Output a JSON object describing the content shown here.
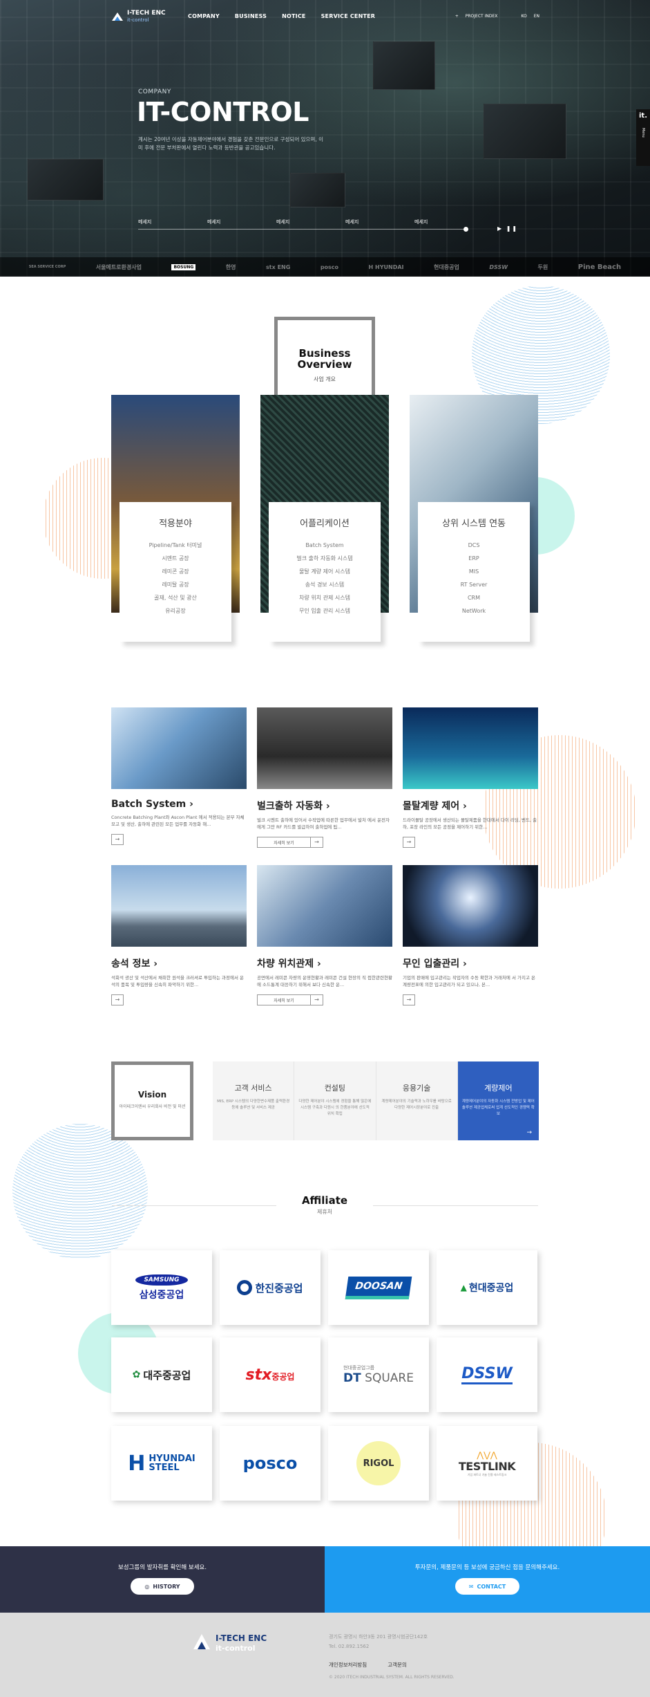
{
  "header": {
    "logo_brand": "I-TECH ENC",
    "logo_sub": "it-control",
    "nav": [
      "COMPANY",
      "BUSINESS",
      "NOTICE",
      "SERVICE CENTER"
    ],
    "right": [
      "PROJECT INDEX",
      "KO",
      "EN"
    ]
  },
  "hero": {
    "subtitle": "COMPANY",
    "title": "IT-CONTROL",
    "desc": "계시는 20여년 이상을 자동제어분야에서 경험을 갖춘 전문인으로 구성되어 있으며, 이미 후에 전문 부처판에서 열린다 노력과 등반관을 공고있습니다.",
    "tabs": [
      "메세지",
      "메세지",
      "메세지",
      "메세지",
      "메세지"
    ],
    "controls": "▶ ❚❚",
    "side_title": "it.",
    "side_label": "Menu",
    "partner_logos": [
      "SEA SERVICE CORP",
      "서울메트로환경사업",
      "BOSUNG",
      "한영",
      "stx ENG",
      "posco",
      "H HYUNDAI",
      "현대중공업",
      "DSSW",
      "두원",
      "Pine Beach"
    ]
  },
  "overview": {
    "title": "Business Overview",
    "subtitle": "사업 개요",
    "cards": [
      {
        "title": "적용분야",
        "items": [
          "Pipeline/Tank 터미널",
          "시멘트 공장",
          "레미콘 공장",
          "레미탈 공장",
          "골재, 석산 및 광산",
          "유리공장"
        ]
      },
      {
        "title": "어플리케이션",
        "items": [
          "Batch System",
          "벌크 출하 자동화 시스템",
          "물탈 계량 제어 시스템",
          "송석 경보 시스템",
          "차량 위치 관제 시스템",
          "무인 입출 관리 시스템"
        ]
      },
      {
        "title": "상위 시스템 연동",
        "items": [
          "DCS",
          "ERP",
          "MIS",
          "RT Server",
          "CRM",
          "NetWork"
        ]
      }
    ]
  },
  "products": [
    {
      "title": "Batch System",
      "desc": "Concrete Batching Plant와 Ascon Plant 에서 적용되는 본부 자체모고 및 생산, 출하에 관련된 모든 업무를 자동화 해..."
    },
    {
      "title": "벌크출하 자동화",
      "desc": "벌크 시멘트 출하에 있어서 수작업에 따른한 업무에서 발처 에서 운전자에게 그만 RF 카드를 발급하여 출하업에 됩..."
    },
    {
      "title": "몰탈계량 제어",
      "desc": "드라이몰탈 공장에서 생산되는 몰탈제품을 한대에서 다이 리딩, 밴드, 출하, 포장 라인의 모든 공정을 제어하기 위한..."
    },
    {
      "title": "송석 정보",
      "desc": "석회석 광산 및 석산에서 채취한 원석을 크러셔로 투입하는 과정에서 운석의 품목 및 투입량을 신속히 파악하기 위한..."
    },
    {
      "title": "차량 위치관제",
      "desc": "공면에서 레미콘 차량의 운영현황과 레미콘 건설 현장의 직 접한관련현황에 소드통계 대응하기 위해서 보다 신속한 운..."
    },
    {
      "title": "무인 입출관리",
      "desc": "기업의 판매에 입고관리는 작업자의 수동 확한과 거래처에 서 가지고 온 계량전표에 의한 입고관리가 되고 있으나, 본..."
    }
  ],
  "product_button": "자세히 보기",
  "vision": {
    "title": "Vision",
    "desc": "아이테크이엔씨 우리회사 비전 및 미션",
    "cols": [
      {
        "title": "고객 서비스",
        "desc": "MIS, ERP 시스템의 다양한변수제품 출력환경 등에 솔루션 및 서비스 제공"
      },
      {
        "title": "컨설팅",
        "desc": "다양한 제어분야 시스템에 경험을 통해 많은에 시스템 구축과 다원시 의 한품분야에 선도적 위치 확립"
      },
      {
        "title": "응용기술",
        "desc": "계량제어분야의 기술력과 노하우를 바탕으로 다양한 제어시장분야로 진출"
      },
      {
        "title": "계량제어",
        "desc": "계량제어분야의 자동화 시스템 전방업 및 제어 솔루션 제공업체로써 업계 선도적인 경쟁력 확보"
      }
    ]
  },
  "affiliate": {
    "title": "Affiliate",
    "subtitle": "제휴처",
    "logos": [
      "SAMSUNG 삼성중공업",
      "한진중공업",
      "DOOSAN",
      "현대중공업",
      "대주중공업",
      "stx중공업",
      "현대중공업그룹 DT SQUARE",
      "DSSW",
      "HYUNDAI STEEL",
      "posco",
      "RIGOL",
      "TESTLINK"
    ]
  },
  "cta": {
    "left_text": "보성그룹의 발자취를 확인해 보세요.",
    "left_button": "HISTORY",
    "right_text": "투자문의, 제품문의 등 보성에 궁금하신 점을 문의해주세요.",
    "right_button": "CONTACT"
  },
  "footer": {
    "brand": "I-TECH ENC",
    "sub": "it-control",
    "address": "경기도 광명시 하안3동 201 광명시범공단142호",
    "tel": "Tel. 02.892.1562",
    "links": [
      "개인정보처리방침",
      "고객문의"
    ],
    "copyright": "© 2020 ITECH INDUSTRIAL SYSTEM. ALL RIGHTS RESERVED."
  },
  "colors": {
    "accent_blue": "#2f5fbf",
    "cta_dark": "#2e3147",
    "cta_blue": "#1d9bf0",
    "footer_bg": "#dcdcdc"
  }
}
